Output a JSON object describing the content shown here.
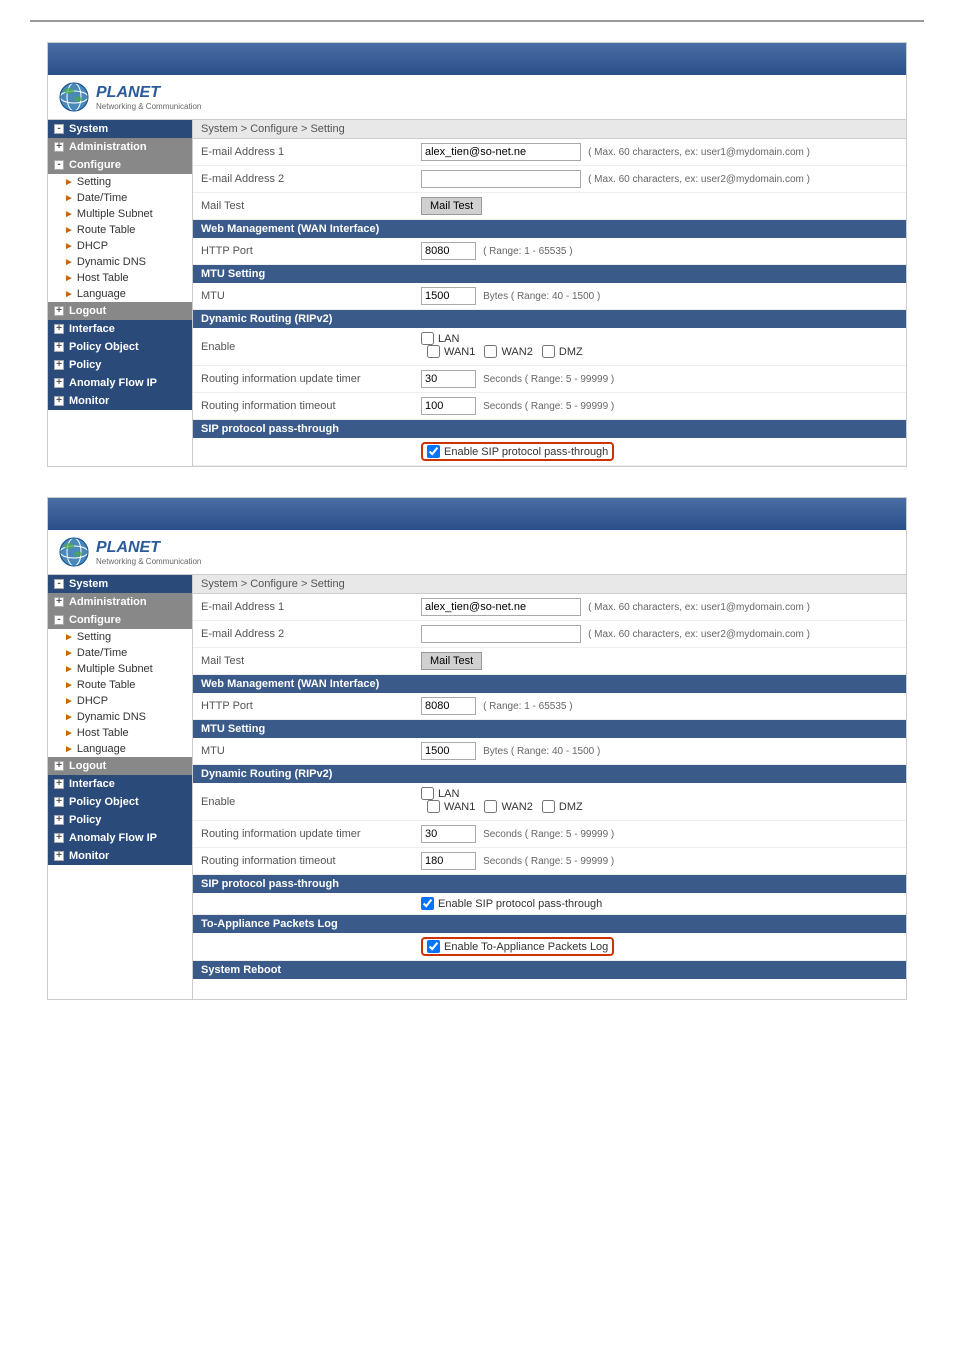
{
  "page": {
    "top_border": true
  },
  "panels": [
    {
      "id": "panel1",
      "breadcrumb": "System > Configure > Setting",
      "logo": {
        "brand": "PLANET",
        "subtitle": "Networking & Communication"
      },
      "sidebar": {
        "sections": [
          {
            "label": "System",
            "type": "blue",
            "expanded": true
          },
          {
            "label": "Administration",
            "type": "gray"
          },
          {
            "label": "Configure",
            "type": "gray",
            "expanded": true
          },
          {
            "label": "Interface",
            "type": "blue"
          },
          {
            "label": "Policy Object",
            "type": "blue"
          },
          {
            "label": "Policy",
            "type": "blue"
          },
          {
            "label": "Anomaly Flow IP",
            "type": "blue"
          },
          {
            "label": "Monitor",
            "type": "blue"
          }
        ],
        "items": [
          {
            "label": "Setting",
            "indent": true
          },
          {
            "label": "Date/Time",
            "indent": true
          },
          {
            "label": "Multiple Subnet",
            "indent": true
          },
          {
            "label": "Route Table",
            "indent": true
          },
          {
            "label": "DHCP",
            "indent": true
          },
          {
            "label": "Dynamic DNS",
            "indent": true
          },
          {
            "label": "Host Table",
            "indent": true
          },
          {
            "label": "Language",
            "indent": true
          },
          {
            "label": "Logout",
            "type": "gray"
          }
        ]
      },
      "form": {
        "sections": [
          {
            "title": "",
            "fields": [
              {
                "label": "E-mail Address 1",
                "type": "input",
                "value": "alex_tien@so-net.ne",
                "hint": "( Max. 60 characters, ex: user1@mydomain.com )"
              },
              {
                "label": "E-mail Address 2",
                "type": "input",
                "value": "",
                "hint": "( Max. 60 characters, ex: user2@mydomain.com )"
              },
              {
                "label": "Mail Test",
                "type": "button",
                "button_label": "Mail Test"
              }
            ]
          },
          {
            "title": "Web Management (WAN Interface)",
            "fields": [
              {
                "label": "HTTP Port",
                "type": "input_small",
                "value": "8080",
                "hint": "( Range: 1 - 65535 )"
              }
            ]
          },
          {
            "title": "MTU Setting",
            "fields": [
              {
                "label": "MTU",
                "type": "input_small",
                "value": "1500",
                "hint": "Bytes ( Range: 40 - 1500 )"
              }
            ]
          },
          {
            "title": "Dynamic Routing (RIPv2)",
            "fields": [
              {
                "label": "Enable",
                "type": "checkboxes",
                "options": [
                  "LAN",
                  "WAN1",
                  "WAN2",
                  "DMZ"
                ]
              },
              {
                "label": "Routing information update timer",
                "type": "input_small",
                "value": "30",
                "hint": "Seconds ( Range: 5 - 99999 )"
              },
              {
                "label": "Routing information timeout",
                "type": "input_small",
                "value": "100",
                "hint": "Seconds ( Range: 5 - 99999 )"
              }
            ]
          },
          {
            "title": "SIP protocol pass-through",
            "fields": [
              {
                "label": "",
                "type": "sip_checkbox",
                "checkbox_label": "Enable SIP protocol pass-through",
                "highlighted": true
              }
            ]
          }
        ]
      }
    },
    {
      "id": "panel2",
      "breadcrumb": "System > Configure > Setting",
      "logo": {
        "brand": "PLANET",
        "subtitle": "Networking & Communication"
      },
      "sidebar": {
        "sections": [
          {
            "label": "System",
            "type": "blue",
            "expanded": true
          },
          {
            "label": "Administration",
            "type": "gray"
          },
          {
            "label": "Configure",
            "type": "gray",
            "expanded": true
          },
          {
            "label": "Interface",
            "type": "blue"
          },
          {
            "label": "Policy Object",
            "type": "blue"
          },
          {
            "label": "Policy",
            "type": "blue"
          },
          {
            "label": "Anomaly Flow IP",
            "type": "blue"
          },
          {
            "label": "Monitor",
            "type": "blue"
          }
        ],
        "items": [
          {
            "label": "Setting",
            "indent": true
          },
          {
            "label": "Date/Time",
            "indent": true
          },
          {
            "label": "Multiple Subnet",
            "indent": true
          },
          {
            "label": "Route Table",
            "indent": true
          },
          {
            "label": "DHCP",
            "indent": true
          },
          {
            "label": "Dynamic DNS",
            "indent": true
          },
          {
            "label": "Host Table",
            "indent": true
          },
          {
            "label": "Language",
            "indent": true
          },
          {
            "label": "Logout",
            "type": "gray"
          }
        ]
      },
      "form": {
        "sections": [
          {
            "title": "",
            "fields": [
              {
                "label": "E-mail Address 1",
                "type": "input",
                "value": "alex_tien@so-net.ne",
                "hint": "( Max. 60 characters, ex: user1@mydomain.com )"
              },
              {
                "label": "E-mail Address 2",
                "type": "input",
                "value": "",
                "hint": "( Max. 60 characters, ex: user2@mydomain.com )"
              },
              {
                "label": "Mail Test",
                "type": "button",
                "button_label": "Mail Test"
              }
            ]
          },
          {
            "title": "Web Management (WAN Interface)",
            "fields": [
              {
                "label": "HTTP Port",
                "type": "input_small",
                "value": "8080",
                "hint": "( Range: 1 - 65535 )"
              }
            ]
          },
          {
            "title": "MTU Setting",
            "fields": [
              {
                "label": "MTU",
                "type": "input_small",
                "value": "1500",
                "hint": "Bytes ( Range: 40 - 1500 )"
              }
            ]
          },
          {
            "title": "Dynamic Routing (RIPv2)",
            "fields": [
              {
                "label": "Enable",
                "type": "checkboxes",
                "options": [
                  "LAN",
                  "WAN1",
                  "WAN2",
                  "DMZ"
                ]
              },
              {
                "label": "Routing information update timer",
                "type": "input_small",
                "value": "30",
                "hint": "Seconds ( Range: 5 - 99999 )"
              },
              {
                "label": "Routing information timeout",
                "type": "input_small",
                "value": "180",
                "hint": "Seconds ( Range: 5 - 99999 )"
              }
            ]
          },
          {
            "title": "SIP protocol pass-through",
            "fields": [
              {
                "label": "",
                "type": "sip_checkbox",
                "checkbox_label": "Enable SIP protocol pass-through",
                "highlighted": false
              }
            ]
          },
          {
            "title": "To-Appliance Packets Log",
            "fields": [
              {
                "label": "",
                "type": "toappliance_checkbox",
                "checkbox_label": "Enable To-Appliance Packets Log",
                "highlighted": true
              }
            ]
          },
          {
            "title": "System Reboot",
            "fields": []
          }
        ]
      }
    }
  ],
  "colors": {
    "sidebar_blue": "#3a5a8a",
    "sidebar_gray": "#888888",
    "header_bg": "#4a6fa5",
    "section_header": "#3a5a8a"
  }
}
